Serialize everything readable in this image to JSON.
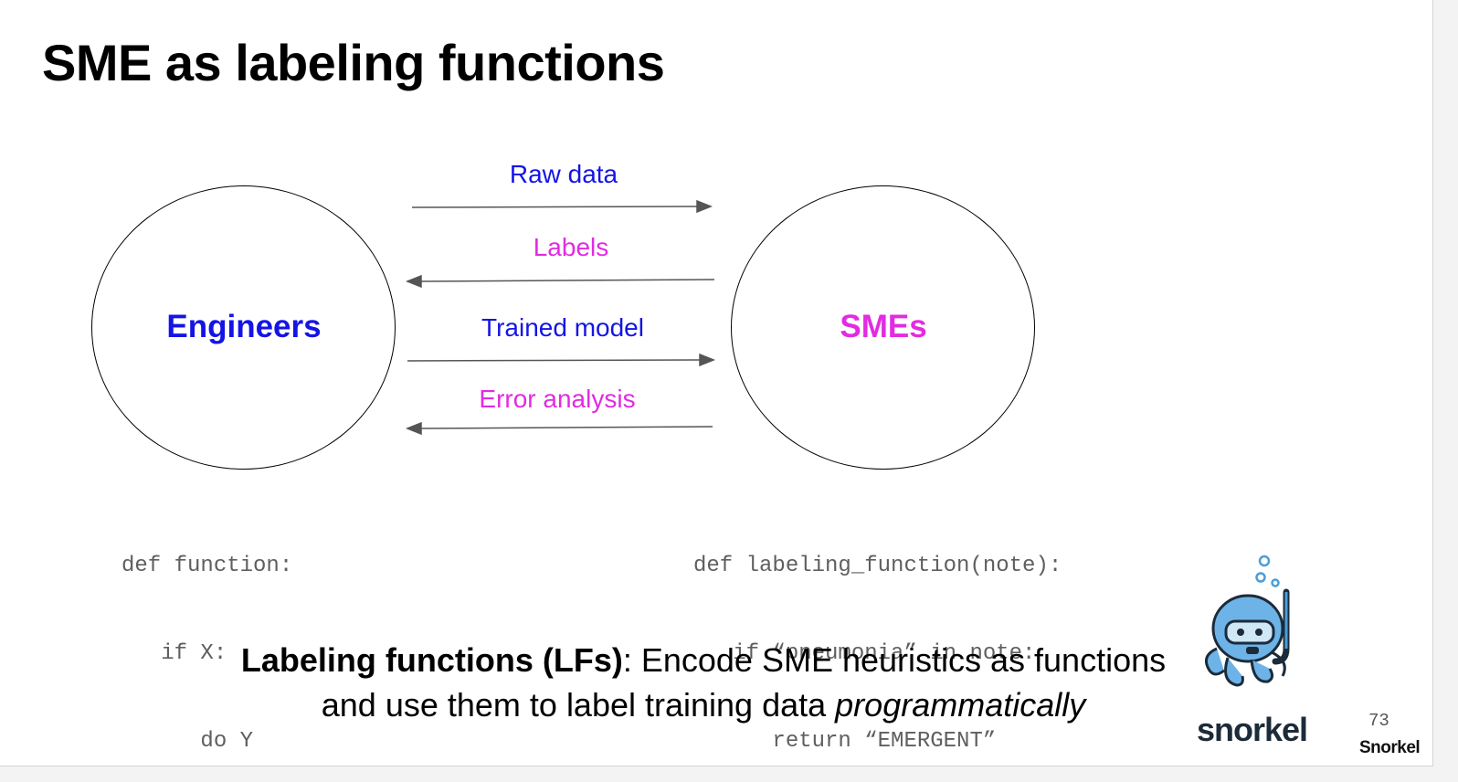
{
  "slide": {
    "title": "SME as labeling functions",
    "page_number": "73",
    "footer_brand": "Snorkel"
  },
  "diagram": {
    "left_node": "Engineers",
    "right_node": "SMEs",
    "flows": [
      {
        "label": "Raw data",
        "direction": "right",
        "color": "#1414e6"
      },
      {
        "label": "Labels",
        "direction": "left",
        "color": "#e22be2"
      },
      {
        "label": "Trained model",
        "direction": "right",
        "color": "#1414e6"
      },
      {
        "label": "Error analysis",
        "direction": "left",
        "color": "#e22be2"
      }
    ]
  },
  "code": {
    "left": [
      "def function:",
      "   if X:",
      "      do Y"
    ],
    "right": [
      "def labeling_function(note):",
      "   if “pneumonia” in note:",
      "      return “EMERGENT”"
    ]
  },
  "caption": {
    "bold": "Labeling functions (LFs)",
    "line1_rest": ": Encode SME heuristics as functions",
    "line2_plain": "and use them to label training data ",
    "line2_italic": "programmatically"
  },
  "logo": {
    "text": "snorkel",
    "icon": "octopus-snorkel-icon"
  },
  "colors": {
    "engineers": "#1414e6",
    "smes": "#e22be2",
    "code": "#5f5f5f"
  }
}
